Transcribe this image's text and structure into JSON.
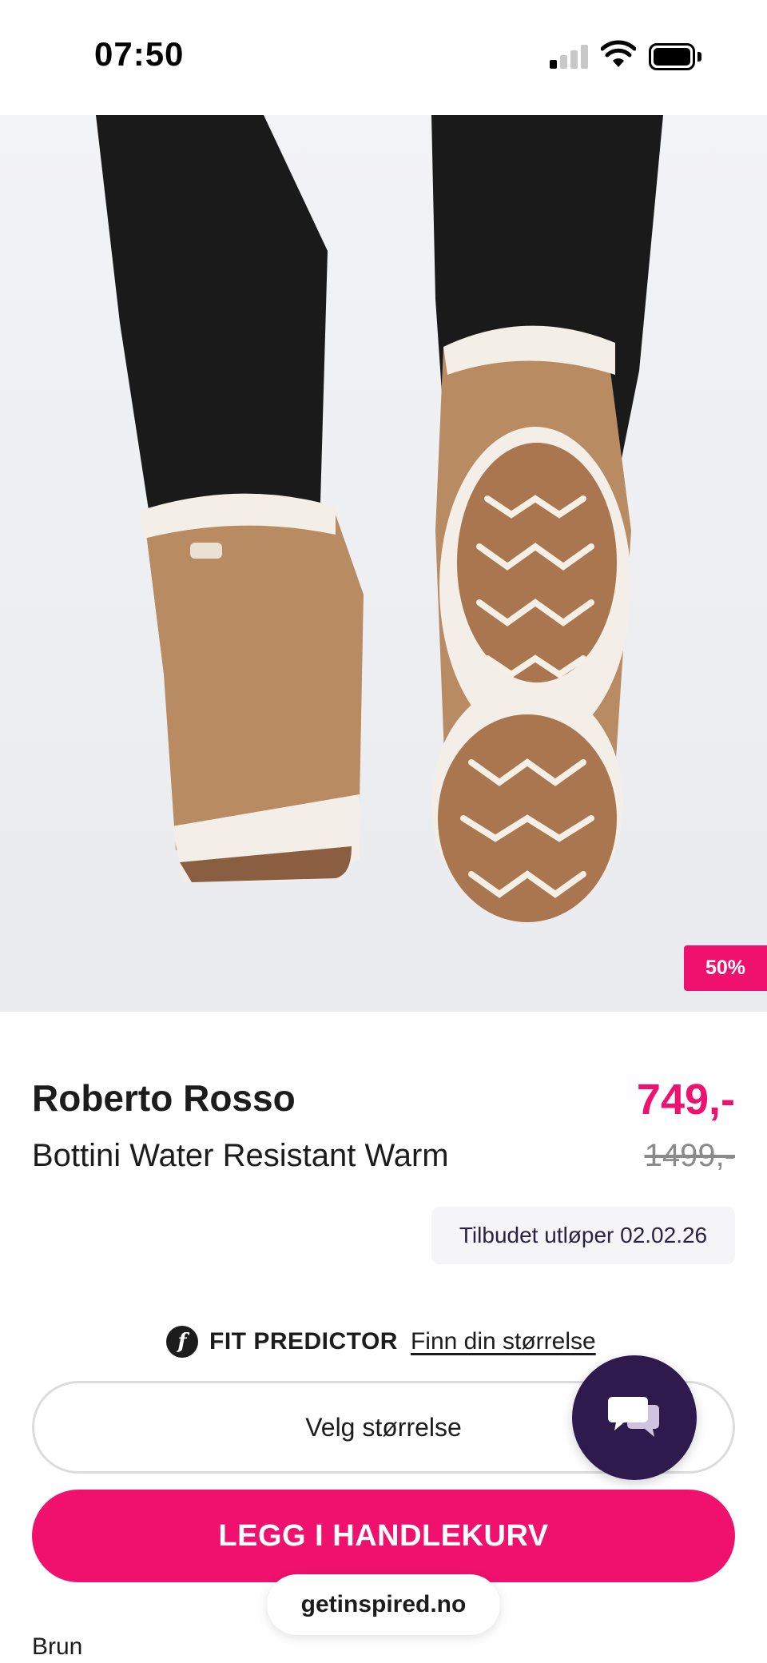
{
  "status_bar": {
    "time": "07:50",
    "icons": [
      "signal-icon",
      "wifi-icon",
      "battery-icon"
    ]
  },
  "product_image": {
    "alt_subject": "boots-photo",
    "carousel": {
      "count": 7,
      "active_index": 2
    },
    "discount_badge": "50%"
  },
  "product": {
    "brand": "Roberto Rosso",
    "name": "Bottini Water Resistant Warm",
    "price": "749,-",
    "old_price": "1499,-",
    "offer_text": "Tilbudet utløper 02.02.26",
    "color": "Brun"
  },
  "fit_predictor": {
    "icon": "f",
    "title": "FIT PREDICTOR",
    "link": "Finn din størrelse"
  },
  "size_select": {
    "label": "Velg størrelse"
  },
  "cart": {
    "label": "LEGG I HANDLEKURV"
  },
  "browser": {
    "url": "getinspired.no"
  },
  "colors": {
    "accent": "#f0116e",
    "chat_bg": "#2f1a4d",
    "offer_bg": "#f5f5f7"
  }
}
